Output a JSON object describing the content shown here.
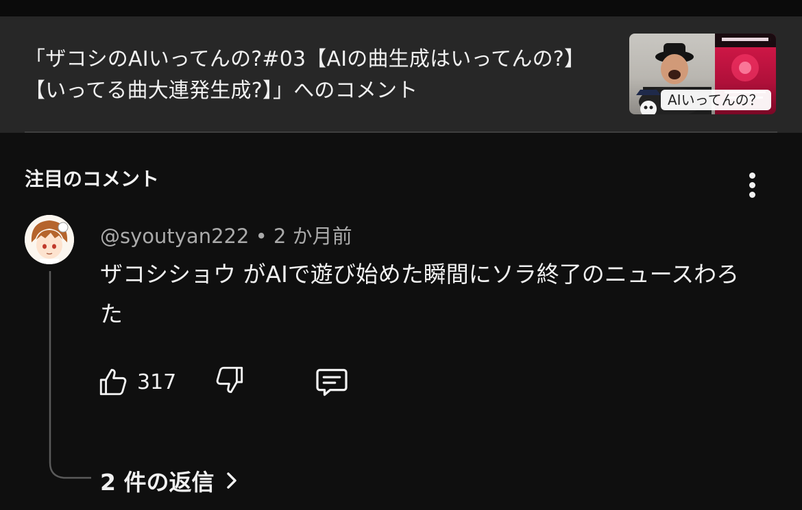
{
  "video": {
    "title": "「ザコシのAIいってんの?#03【AIの曲生成はいってんの?】【いってる曲大連発生成?】」へのコメント",
    "thumbnail_caption": "AIいってんの？"
  },
  "section": {
    "title": "注目のコメント"
  },
  "comment": {
    "author": "@syoutyan222",
    "separator": " • ",
    "time": "2 か月前",
    "text": "ザコシショウ がAIで遊び始めた瞬間にソラ終了のニュースわろた",
    "like_count": "317",
    "replies_label": "2 件の返信"
  },
  "icons": {
    "more": "more-vert-icon",
    "like": "thumb-up-icon",
    "dislike": "thumb-down-icon",
    "reply": "comment-icon",
    "chevron": "chevron-right-icon"
  },
  "colors": {
    "background": "#0f0f0f",
    "header_background": "#272727",
    "primary_text": "#f1f1f1",
    "secondary_text": "#aaaaaa"
  }
}
